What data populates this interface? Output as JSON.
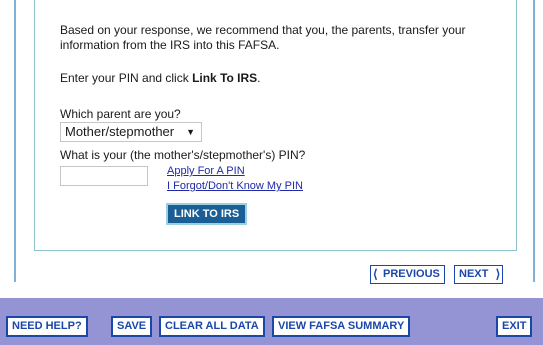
{
  "content": {
    "intro_text": "Based on your response, we recommend that you, the parents, transfer your information from the IRS into this FAFSA.",
    "instruction_prefix": "Enter your PIN and click ",
    "instruction_bold": "Link To IRS",
    "instruction_suffix": ".",
    "parent_question": "Which parent are you?",
    "parent_selected": "Mother/stepmother",
    "pin_question": "What is your (the mother's/stepmother's) PIN?",
    "pin_value": "",
    "apply_link": "Apply For A PIN",
    "forgot_link": "I Forgot/Don't Know My PIN",
    "link_button": "LINK TO IRS"
  },
  "navigation": {
    "previous": "PREVIOUS",
    "next": "NEXT"
  },
  "footer": {
    "need_help": "NEED HELP?",
    "save": "SAVE",
    "clear_all": "CLEAR ALL DATA",
    "view_summary": "VIEW FAFSA SUMMARY",
    "exit": "EXIT"
  },
  "colors": {
    "footer_background": "#9494d4",
    "button_text": "#1a47a8",
    "link_button_background": "#1a5e95",
    "link_text": "#1e2aa8",
    "panel_border": "#8fc2cc"
  }
}
